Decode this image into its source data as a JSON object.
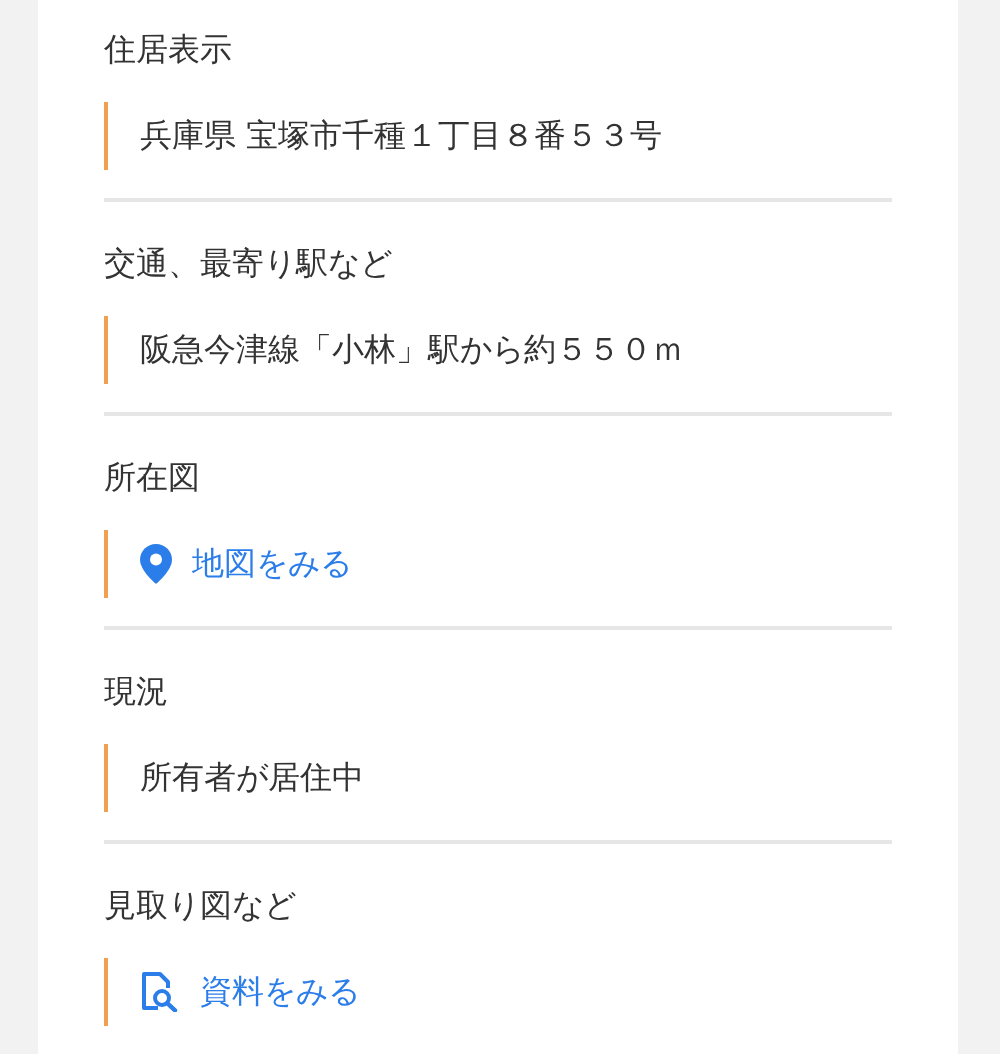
{
  "sections": [
    {
      "label": "住居表示",
      "kind": "text",
      "value": "兵庫県 宝塚市千種１丁目８番５３号"
    },
    {
      "label": "交通、最寄り駅など",
      "kind": "text",
      "value": "阪急今津線「小林」駅から約５５０ｍ"
    },
    {
      "label": "所在図",
      "kind": "map-link",
      "value": "地図をみる"
    },
    {
      "label": "現況",
      "kind": "text",
      "value": "所有者が居住中"
    },
    {
      "label": "見取り図など",
      "kind": "doc-link",
      "value": "資料をみる"
    }
  ]
}
